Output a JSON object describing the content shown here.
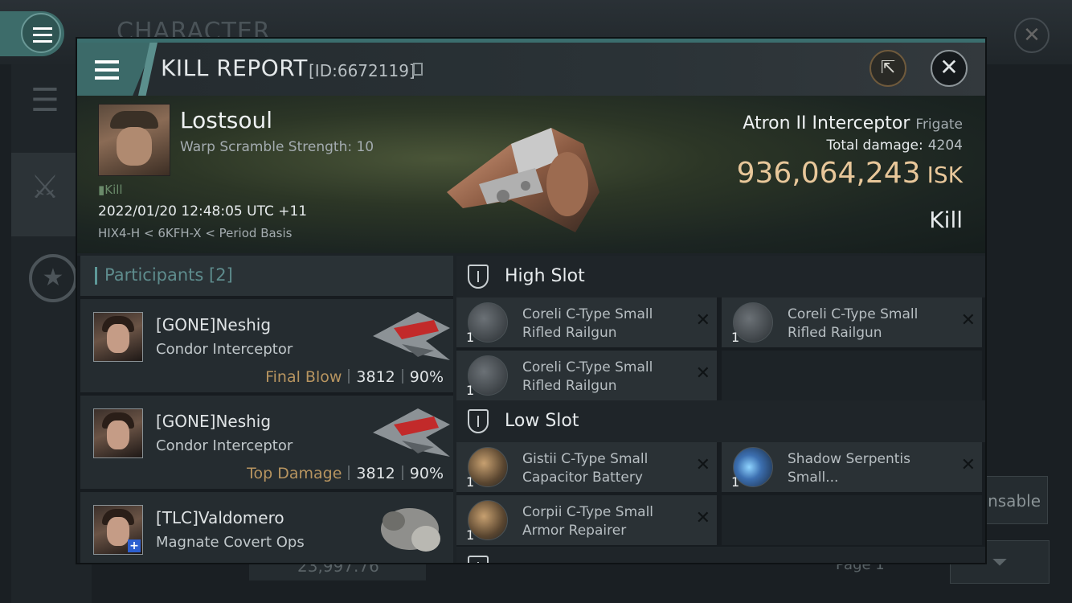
{
  "background": {
    "title": "CHARACTER",
    "dispensable_label": "ensable",
    "balance": "23,997.76",
    "page": "Page 1"
  },
  "header": {
    "title": "KILL REPORT",
    "id": "[ID:6672119]"
  },
  "victim": {
    "name": "Lostsoul",
    "subtitle": "Warp Scramble Strength: 10",
    "kill_tag": "Kill",
    "datetime": "2022/01/20 12:48:05 UTC +11",
    "location": "HIX4-H < 6KFH-X < Period Basis",
    "ship": "Atron II Interceptor",
    "ship_class": "Frigate",
    "damage_label": "Total damage:",
    "damage_value": "4204",
    "isk_value": "936,064,243",
    "isk_unit": "ISK",
    "kill_type": "Kill"
  },
  "participants": {
    "title": "Participants",
    "count": "[2]",
    "rows": [
      {
        "name": "[GONE]Neshig",
        "ship": "Condor Interceptor",
        "label": "Final Blow",
        "damage": "3812",
        "percent": "90%"
      },
      {
        "name": "[GONE]Neshig",
        "ship": "Condor Interceptor",
        "label": "Top Damage",
        "damage": "3812",
        "percent": "90%"
      },
      {
        "name": "[TLC]Valdomero",
        "ship": "Magnate Covert Ops",
        "label": "",
        "damage": "",
        "percent": ""
      }
    ]
  },
  "slots": {
    "high": {
      "title": "High Slot",
      "items": [
        {
          "qty": "1",
          "name": "Coreli C-Type Small Rifled Railgun"
        },
        {
          "qty": "1",
          "name": "Coreli C-Type Small Rifled Railgun"
        },
        {
          "qty": "1",
          "name": "Coreli C-Type Small Rifled Railgun"
        }
      ]
    },
    "low": {
      "title": "Low Slot",
      "items": [
        {
          "qty": "1",
          "name": "Gistii C-Type Small Capacitor Battery"
        },
        {
          "qty": "1",
          "name": "Shadow Serpentis Small..."
        },
        {
          "qty": "1",
          "name": "Corpii C-Type Small Armor Repairer"
        }
      ]
    }
  },
  "icons": {
    "menu": "menu-icon",
    "close": "close-icon",
    "share": "external-link-icon",
    "copy": "copy-icon",
    "remove": "x-icon"
  },
  "colors": {
    "accent": "#3c6a69",
    "isk": "#e8c79a",
    "final_blow": "#b89560"
  }
}
